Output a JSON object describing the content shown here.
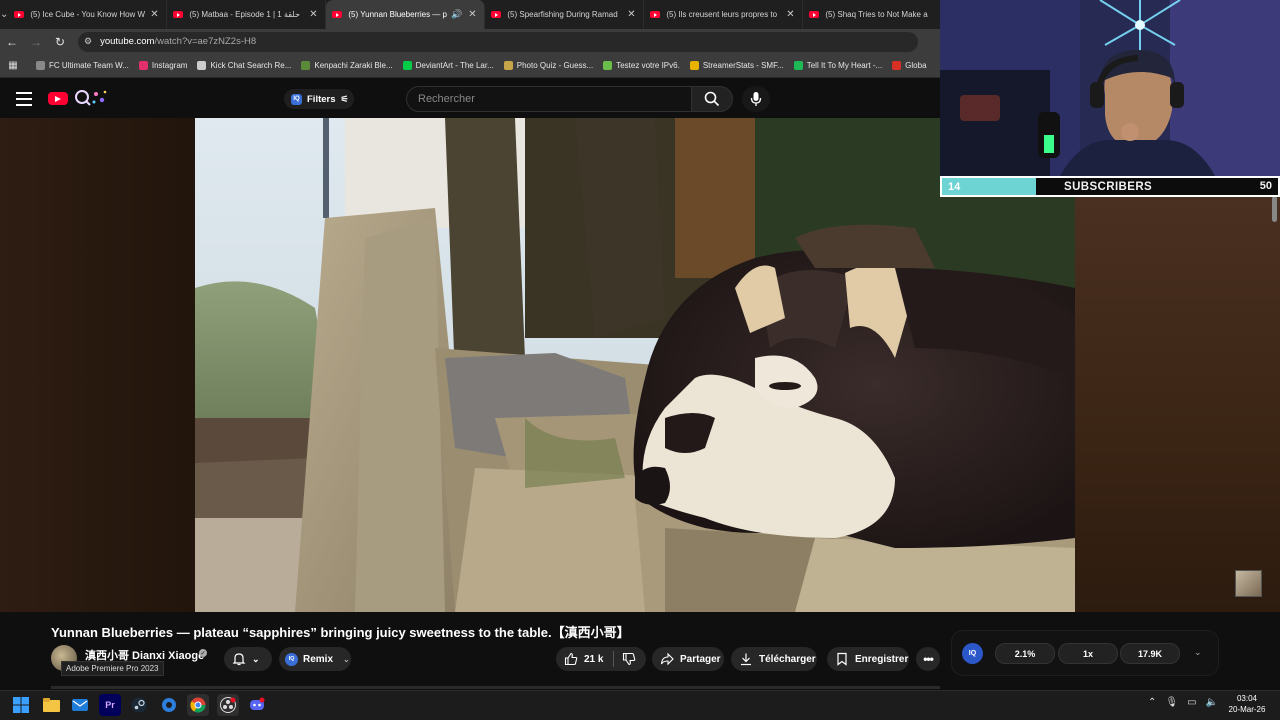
{
  "browser": {
    "tabs": [
      {
        "title": "(5) Ice Cube - You Know How W",
        "active": false
      },
      {
        "title": "(5) Matbaa - Episode 1 | 1 حلقة",
        "active": false
      },
      {
        "title": "(5) Yunnan Blueberries — p",
        "active": true
      },
      {
        "title": "(5) Spearfishing During Ramad",
        "active": false
      },
      {
        "title": "(5) Ils creusent leurs propres to",
        "active": false
      },
      {
        "title": "(5) Shaq Tries to Not Make a",
        "active": false
      }
    ],
    "url_host": "youtube.com",
    "url_path": "/watch?v=ae7zNZ2s-H8",
    "bookmarks": [
      {
        "label": "FC Ultimate Team W...",
        "color": "#888888"
      },
      {
        "label": "Instagram",
        "color": "#e1306c"
      },
      {
        "label": "Kick Chat Search Re...",
        "color": "#cccccc"
      },
      {
        "label": "Kenpachi Zaraki Ble...",
        "color": "#5a8a3a"
      },
      {
        "label": "DeviantArt - The Lar...",
        "color": "#05cc47"
      },
      {
        "label": "Photo Quiz - Guess...",
        "color": "#c8a44a"
      },
      {
        "label": "Testez votre IPv6.",
        "color": "#6abf4b"
      },
      {
        "label": "StreamerStats - SMF...",
        "color": "#e8b200"
      },
      {
        "label": "Tell It To My Heart -...",
        "color": "#1db954"
      },
      {
        "label": "Globa",
        "color": "#d93025"
      }
    ]
  },
  "youtube": {
    "filters_label": "Filters",
    "search_placeholder": "Rechercher",
    "video_title": "Yunnan Blueberries — plateau “sapphires” bringing juicy sweetness to the table.【滇西小哥】",
    "channel_name": "滇西小哥 Dianxi Xiaoge",
    "tooltip": "Adobe Premiere Pro 2023",
    "remix_label": "Remix",
    "likes": "21 k",
    "share_label": "Partager",
    "download_label": "Télécharger",
    "save_label": "Enregistrer"
  },
  "extension": {
    "logo": "IQ",
    "rate": "2.1%",
    "speed": "1x",
    "views": "17.9K"
  },
  "stream_overlay": {
    "subscribers_label": "SUBSCRIBERS",
    "current": "14",
    "goal": "50",
    "progress_fraction": 0.28
  },
  "taskbar": {
    "time": "03:04",
    "date": "20-Mar-26"
  },
  "colors": {
    "youtube_red": "#ff0033",
    "sub_bar": "#6dd3d3",
    "accent_blue": "#3b6fd8"
  }
}
